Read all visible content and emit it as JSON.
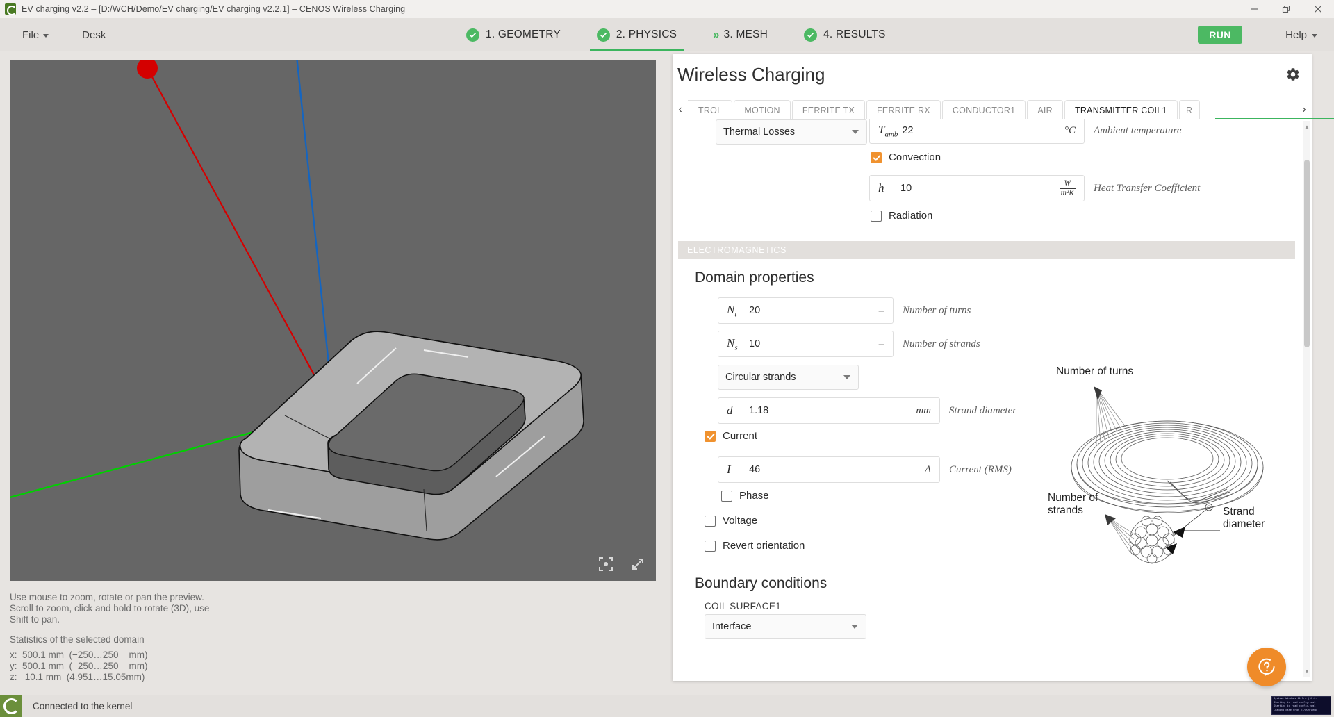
{
  "window": {
    "title": "EV charging v2.2 – [D:/WCH/Demo/EV charging/EV charging v2.2.1] – CENOS Wireless Charging",
    "minimize_label": "Minimize",
    "restore_label": "Restore",
    "close_label": "Close"
  },
  "menubar": {
    "file": "File",
    "desk": "Desk",
    "run": "RUN",
    "help": "Help",
    "steps": [
      {
        "label": "1. GEOMETRY",
        "icon": "check-circle-icon",
        "state": "done"
      },
      {
        "label": "2. PHYSICS",
        "icon": "check-circle-icon",
        "state": "active"
      },
      {
        "label": "3. MESH",
        "icon": "double-chevron-icon",
        "state": "pending"
      },
      {
        "label": "4. RESULTS",
        "icon": "check-circle-icon",
        "state": "done"
      }
    ]
  },
  "viewport": {
    "hint": "Use mouse to zoom, rotate or pan the preview.\nScroll to zoom, click and hold to rotate (3D), use\nShift to pan.",
    "stats_title": "Statistics of the selected domain",
    "stats": [
      "x:  500.1 mm  (−250…250    mm)",
      "y:  500.1 mm  (−250…250    mm)",
      "z:   10.1 mm  (4.951…15.05mm)"
    ],
    "center_icon": "focus-target-icon",
    "expand_icon": "fullscreen-icon"
  },
  "panel": {
    "title": "Wireless Charging",
    "settings_icon": "gear-icon",
    "tab_prev": "‹",
    "tab_next": "›",
    "tabs": [
      {
        "label": "TROL",
        "selected": false,
        "clipped": true
      },
      {
        "label": "MOTION",
        "selected": false
      },
      {
        "label": "FERRITE TX",
        "selected": false
      },
      {
        "label": "FERRITE RX",
        "selected": false
      },
      {
        "label": "CONDUCTOR1",
        "selected": false
      },
      {
        "label": "AIR",
        "selected": false
      },
      {
        "label": "TRANSMITTER COIL1",
        "selected": true
      },
      {
        "label": "R",
        "selected": false,
        "clipped": true
      }
    ],
    "thermal": {
      "losses_select": "Thermal Losses",
      "ambient": {
        "symbol": "T",
        "subscript": "amb",
        "value": "22",
        "unit": "°C",
        "description": "Ambient temperature"
      },
      "convection": {
        "label": "Convection",
        "checked": true
      },
      "htc": {
        "symbol": "h",
        "value": "10",
        "unit_num": "W",
        "unit_den": "m²K",
        "description": "Heat Transfer Coefficient"
      },
      "radiation": {
        "label": "Radiation",
        "checked": false
      }
    },
    "electromagnetics": {
      "section_title": "ELECTROMAGNETICS",
      "domain_properties_title": "Domain properties",
      "turns": {
        "symbol": "N",
        "subscript": "t",
        "value": "20",
        "unit": "–",
        "description": "Number of turns"
      },
      "strands": {
        "symbol": "N",
        "subscript": "s",
        "value": "10",
        "unit": "–",
        "description": "Number of strands"
      },
      "strand_type_select": "Circular strands",
      "strand_diameter": {
        "symbol": "d",
        "value": "1.18",
        "unit": "mm",
        "description": "Strand diameter"
      },
      "current_cb": {
        "label": "Current",
        "checked": true
      },
      "current": {
        "symbol": "I",
        "value": "46",
        "unit": "A",
        "description": "Current (RMS)"
      },
      "phase_cb": {
        "label": "Phase",
        "checked": false
      },
      "voltage_cb": {
        "label": "Voltage",
        "checked": false
      },
      "revert_cb": {
        "label": "Revert orientation",
        "checked": false
      },
      "boundary_title": "Boundary conditions",
      "boundary_surface_label": "COIL SURFACE1",
      "boundary_select": "Interface"
    },
    "figure": {
      "label_turns": "Number of turns",
      "label_strands_line1": "Number of",
      "label_strands_line2": "strands",
      "label_diameter_line1": "Strand",
      "label_diameter_line2": "diameter"
    },
    "help_fab_icon": "question-bubble-icon"
  },
  "statusbar": {
    "logo_icon": "cenos-logo-icon",
    "text": "Connected to the kernel",
    "log_lines": [
      "System: Windows 11 Pro (10.0.",
      "Starting to read config.yaml",
      "Starting to read config.yaml",
      "Loading case from D:/WCH/Demo"
    ]
  },
  "colors": {
    "accent_green": "#4cb963",
    "accent_orange": "#ef8b29",
    "chrome": "#e3e0dd",
    "viewport_bg": "#666666"
  }
}
